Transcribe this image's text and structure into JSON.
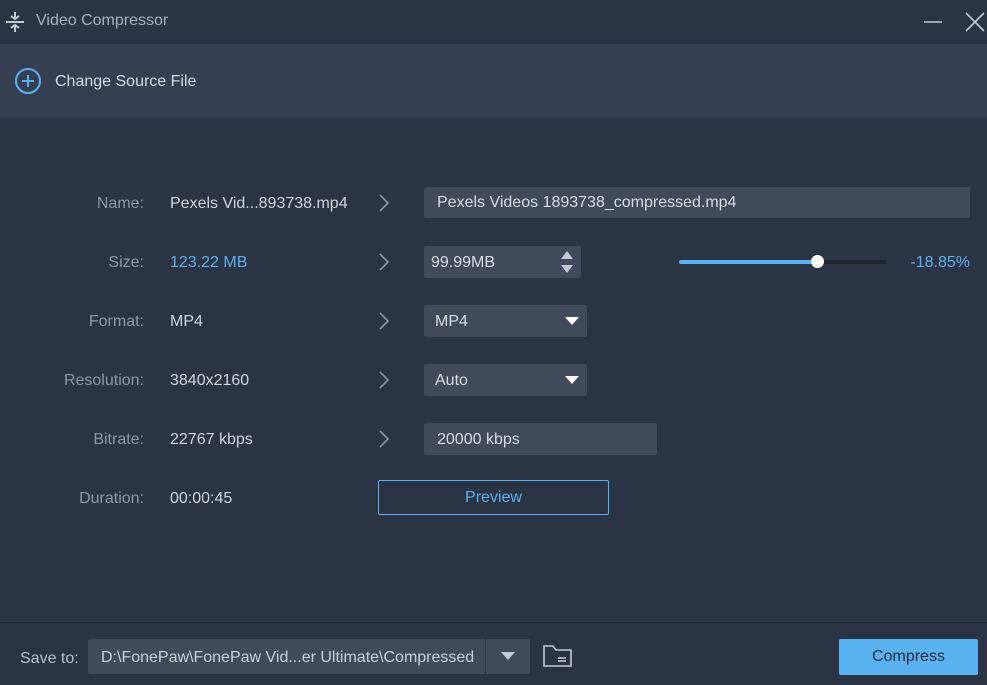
{
  "window": {
    "title": "Video Compressor",
    "app_icon": "compress-icon"
  },
  "source": {
    "change_label": "Change Source File",
    "icon": "add-circle-icon"
  },
  "fields": {
    "name": {
      "label": "Name:",
      "source": "Pexels Vid...893738.mp4",
      "output": "Pexels Videos 1893738_compressed.mp4"
    },
    "size": {
      "label": "Size:",
      "source": "123.22 MB",
      "output": "99.99MB",
      "percent": "-18.85%",
      "slider_fraction": 0.6667
    },
    "format": {
      "label": "Format:",
      "source": "MP4",
      "selected": "MP4"
    },
    "resolution": {
      "label": "Resolution:",
      "source": "3840x2160",
      "selected": "Auto"
    },
    "bitrate": {
      "label": "Bitrate:",
      "source": "22767 kbps",
      "output": "20000 kbps"
    },
    "duration": {
      "label": "Duration:",
      "source": "00:00:45"
    }
  },
  "preview_label": "Preview",
  "footer": {
    "save_to_label": "Save to:",
    "path": "D:\\FonePaw\\FonePaw Vid...er Ultimate\\Compressed",
    "compress_label": "Compress"
  },
  "colors": {
    "accent": "#5ab1ef",
    "background": "#2b3444",
    "field": "#404a5b"
  }
}
